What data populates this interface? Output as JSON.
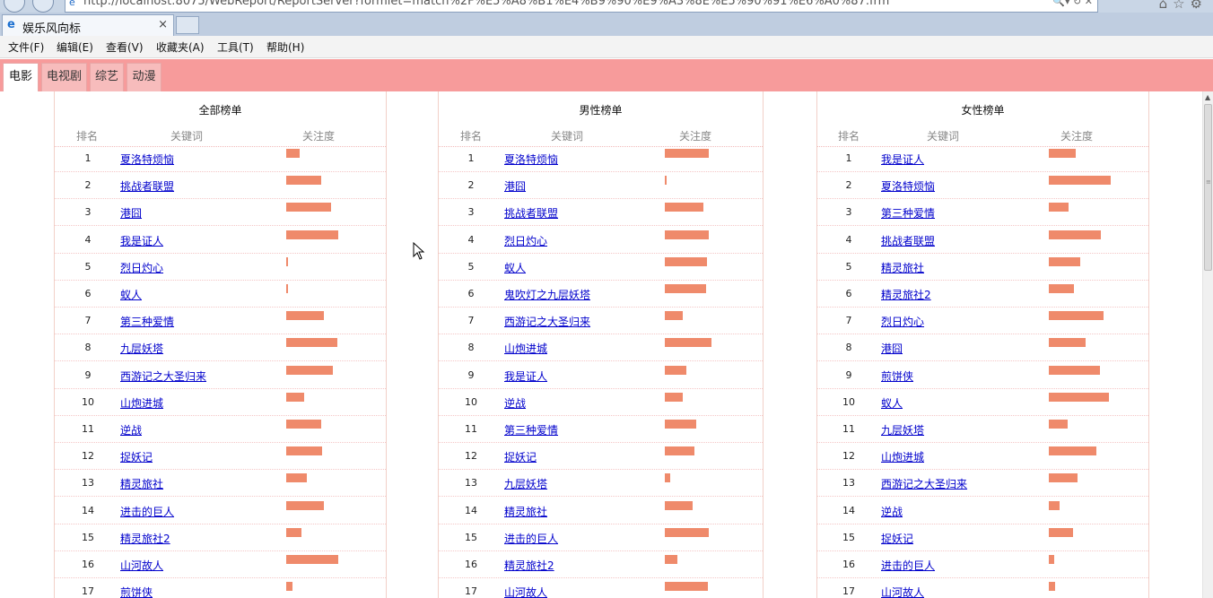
{
  "browser": {
    "url": "http://localhost:8075/WebReport/ReportServer?formlet=match%2F%E5%A8%B1%E4%B9%90%E9%A3%8E%E5%90%91%E6%A0%87.frm",
    "tab_title": "娱乐风向标",
    "tab_close": "×",
    "menu": [
      "文件(F)",
      "编辑(E)",
      "查看(V)",
      "收藏夹(A)",
      "工具(T)",
      "帮助(H)"
    ]
  },
  "report_tabs": [
    {
      "label": "电影",
      "active": true
    },
    {
      "label": "电视剧",
      "active": false
    },
    {
      "label": "综艺",
      "active": false
    },
    {
      "label": "动漫",
      "active": false
    }
  ],
  "headers": {
    "rank": "排名",
    "keyword": "关键词",
    "attention": "关注度"
  },
  "colors": {
    "tab_bar": "#f79b9b",
    "bar": "#ef8a6b",
    "link": "#0000cc"
  },
  "panels": [
    {
      "title": "全部榜单",
      "rows": [
        {
          "rank": "1",
          "keyword": "夏洛特烦恼",
          "attention": 0.26
        },
        {
          "rank": "2",
          "keyword": "挑战者联盟",
          "attention": 0.67
        },
        {
          "rank": "3",
          "keyword": "港囧",
          "attention": 0.86
        },
        {
          "rank": "4",
          "keyword": "我是证人",
          "attention": 1.0
        },
        {
          "rank": "5",
          "keyword": "烈日灼心",
          "attention": 0.03
        },
        {
          "rank": "6",
          "keyword": "蚁人",
          "attention": 0.03
        },
        {
          "rank": "7",
          "keyword": "第三种爱情",
          "attention": 0.72
        },
        {
          "rank": "8",
          "keyword": "九层妖塔",
          "attention": 0.98
        },
        {
          "rank": "9",
          "keyword": "西游记之大圣归来",
          "attention": 0.9
        },
        {
          "rank": "10",
          "keyword": "山炮进城",
          "attention": 0.34
        },
        {
          "rank": "11",
          "keyword": "逆战",
          "attention": 0.67
        },
        {
          "rank": "12",
          "keyword": "捉妖记",
          "attention": 0.69
        },
        {
          "rank": "13",
          "keyword": "精灵旅社",
          "attention": 0.4
        },
        {
          "rank": "14",
          "keyword": "进击的巨人",
          "attention": 0.72
        },
        {
          "rank": "15",
          "keyword": "精灵旅社2",
          "attention": 0.29
        },
        {
          "rank": "16",
          "keyword": "山河故人",
          "attention": 1.0
        },
        {
          "rank": "17",
          "keyword": "煎饼侠",
          "attention": 0.12
        }
      ]
    },
    {
      "title": "男性榜单",
      "rows": [
        {
          "rank": "1",
          "keyword": "夏洛特烦恼",
          "attention": 0.94
        },
        {
          "rank": "2",
          "keyword": "港囧",
          "attention": 0.04
        },
        {
          "rank": "3",
          "keyword": "挑战者联盟",
          "attention": 0.83
        },
        {
          "rank": "4",
          "keyword": "烈日灼心",
          "attention": 0.94
        },
        {
          "rank": "5",
          "keyword": "蚁人",
          "attention": 0.91
        },
        {
          "rank": "6",
          "keyword": "鬼吹灯之九层妖塔",
          "attention": 0.89
        },
        {
          "rank": "7",
          "keyword": "西游记之大圣归来",
          "attention": 0.38
        },
        {
          "rank": "8",
          "keyword": "山炮进城",
          "attention": 1.0
        },
        {
          "rank": "9",
          "keyword": "我是证人",
          "attention": 0.47
        },
        {
          "rank": "10",
          "keyword": "逆战",
          "attention": 0.38
        },
        {
          "rank": "11",
          "keyword": "第三种爱情",
          "attention": 0.68
        },
        {
          "rank": "12",
          "keyword": "捉妖记",
          "attention": 0.64
        },
        {
          "rank": "13",
          "keyword": "九层妖塔",
          "attention": 0.11
        },
        {
          "rank": "14",
          "keyword": "精灵旅社",
          "attention": 0.6
        },
        {
          "rank": "15",
          "keyword": "进击的巨人",
          "attention": 0.94
        },
        {
          "rank": "16",
          "keyword": "精灵旅社2",
          "attention": 0.26
        },
        {
          "rank": "17",
          "keyword": "山河故人",
          "attention": 0.92
        }
      ]
    },
    {
      "title": "女性榜单",
      "rows": [
        {
          "rank": "1",
          "keyword": "我是证人",
          "attention": 0.43
        },
        {
          "rank": "2",
          "keyword": "夏洛特烦恼",
          "attention": 1.0
        },
        {
          "rank": "3",
          "keyword": "第三种爱情",
          "attention": 0.32
        },
        {
          "rank": "4",
          "keyword": "挑战者联盟",
          "attention": 0.84
        },
        {
          "rank": "5",
          "keyword": "精灵旅社",
          "attention": 0.5
        },
        {
          "rank": "6",
          "keyword": "精灵旅社2",
          "attention": 0.41
        },
        {
          "rank": "7",
          "keyword": "烈日灼心",
          "attention": 0.88
        },
        {
          "rank": "8",
          "keyword": "港囧",
          "attention": 0.6
        },
        {
          "rank": "9",
          "keyword": "煎饼侠",
          "attention": 0.82
        },
        {
          "rank": "10",
          "keyword": "蚁人",
          "attention": 0.97
        },
        {
          "rank": "11",
          "keyword": "九层妖塔",
          "attention": 0.3
        },
        {
          "rank": "12",
          "keyword": "山炮进城",
          "attention": 0.77
        },
        {
          "rank": "13",
          "keyword": "西游记之大圣归来",
          "attention": 0.46
        },
        {
          "rank": "14",
          "keyword": "逆战",
          "attention": 0.18
        },
        {
          "rank": "15",
          "keyword": "捉妖记",
          "attention": 0.39
        },
        {
          "rank": "16",
          "keyword": "进击的巨人",
          "attention": 0.09
        },
        {
          "rank": "17",
          "keyword": "山河故人",
          "attention": 0.1
        }
      ]
    }
  ]
}
